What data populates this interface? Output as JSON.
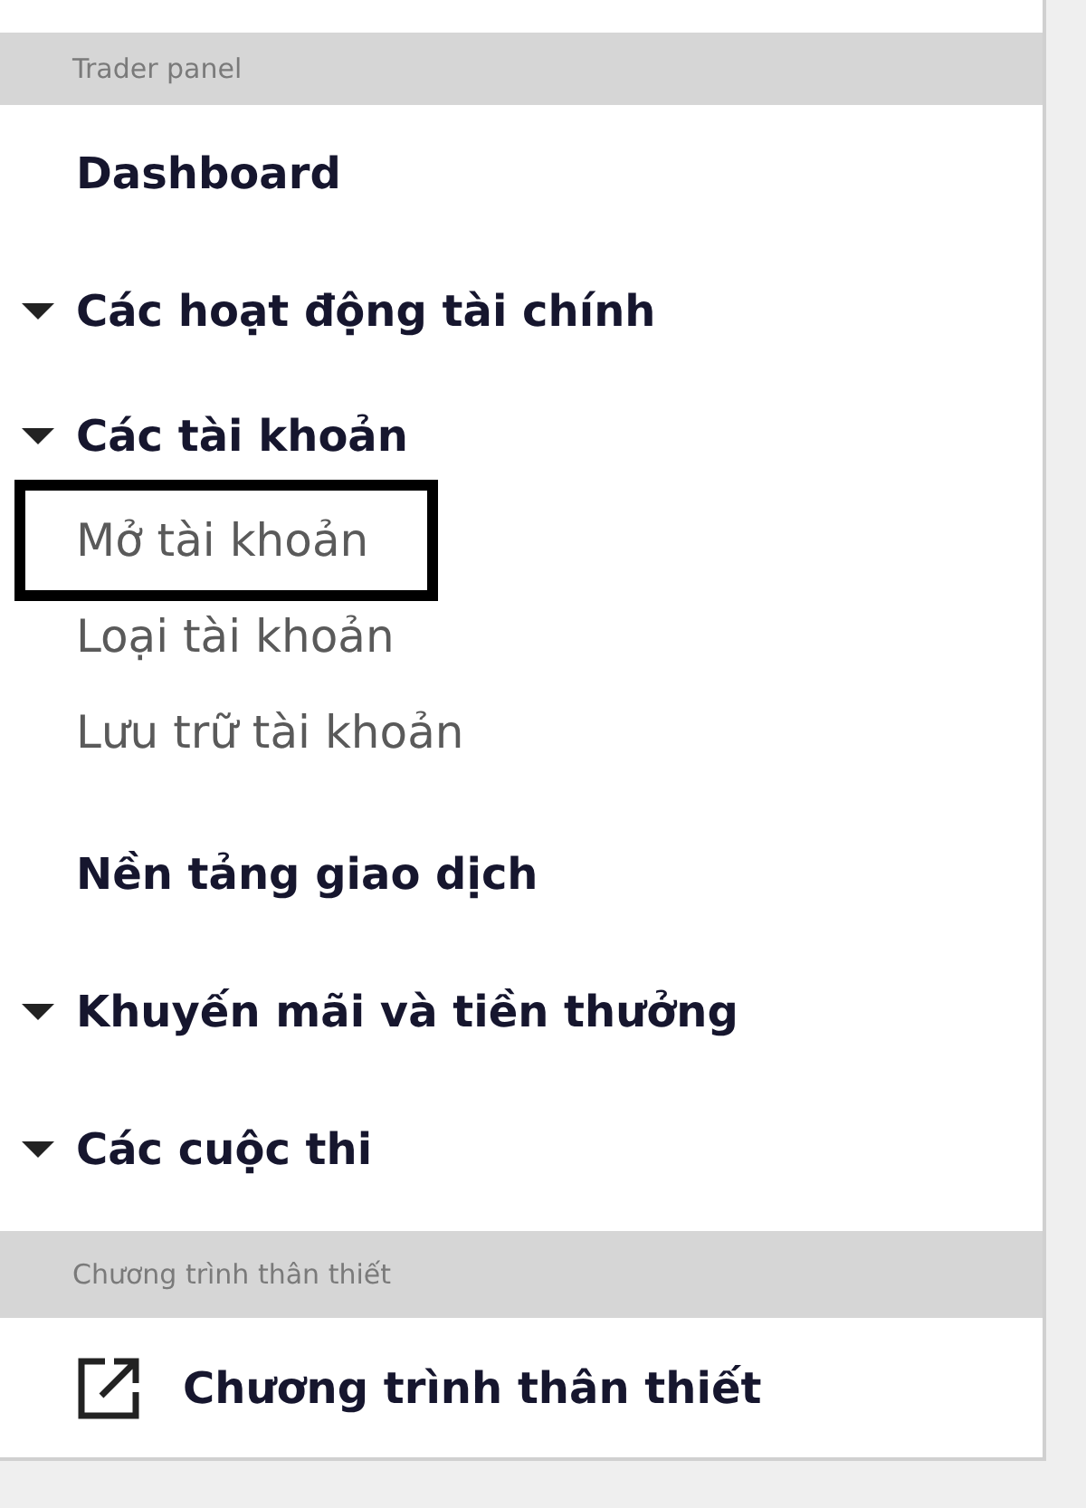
{
  "sections": [
    {
      "header": "Trader panel",
      "items": [
        {
          "label": "Dashboard",
          "kind": "link"
        },
        {
          "label": "Các hoạt động tài chính",
          "kind": "group"
        },
        {
          "label": "Các tài khoản",
          "kind": "group",
          "children": [
            {
              "label": "Mở tài khoản",
              "highlighted": true
            },
            {
              "label": "Loại tài khoản",
              "highlighted": false
            },
            {
              "label": "Lưu trữ tài khoản",
              "highlighted": false
            }
          ]
        },
        {
          "label": "Nền tảng giao dịch",
          "kind": "link"
        },
        {
          "label": "Khuyến mãi và tiền thưởng",
          "kind": "group"
        },
        {
          "label": "Các cuộc thi",
          "kind": "group"
        }
      ]
    },
    {
      "header": "Chương trình thân thiết",
      "items": [
        {
          "label": "Chương trình thân thiết",
          "kind": "external"
        }
      ]
    }
  ]
}
